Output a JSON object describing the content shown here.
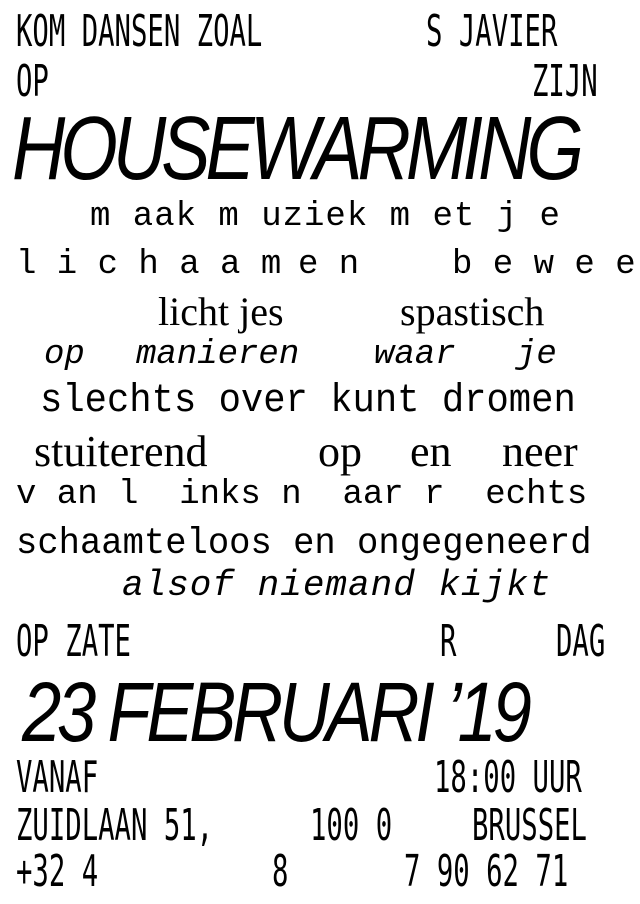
{
  "header": {
    "line1_left": "KOM DANSEN ZOAL",
    "line1_right": "S JAVIER",
    "line2_left": "OP",
    "line2_right": "ZIJN"
  },
  "title": "HOUSEWARMING",
  "body": {
    "line1": "m aak m uziek m et j e",
    "line2_a": "l i c h a a m",
    "line2_b": "e n",
    "line2_c": "b e w e e g",
    "line3_a": "licht jes",
    "line3_b": "spastisch",
    "line4_a": "op",
    "line4_b": "manieren",
    "line4_c": "waar",
    "line4_d": "je",
    "line5": "slechts over kunt dromen",
    "line6_a": "stuiterend",
    "line6_b": "op",
    "line6_c": "en",
    "line6_d": "neer",
    "line7": "v an l  inks n  aar r  echts",
    "line8": "schaamteloos en ongegeneerd",
    "line9": "alsof niemand kijkt"
  },
  "date_prefix": {
    "left": "OP ZATE",
    "mid": "R",
    "right": "DAG"
  },
  "date": "23 FEBRUARI ’19",
  "footer": {
    "from_label": "VANAF",
    "time": "18:00 UUR",
    "address": "ZUIDLAAN 51,",
    "postcode": "100 0",
    "city": "BRUSSEL",
    "phone_1": "+32 4",
    "phone_2": "8",
    "phone_3": "7 90 62 71"
  }
}
